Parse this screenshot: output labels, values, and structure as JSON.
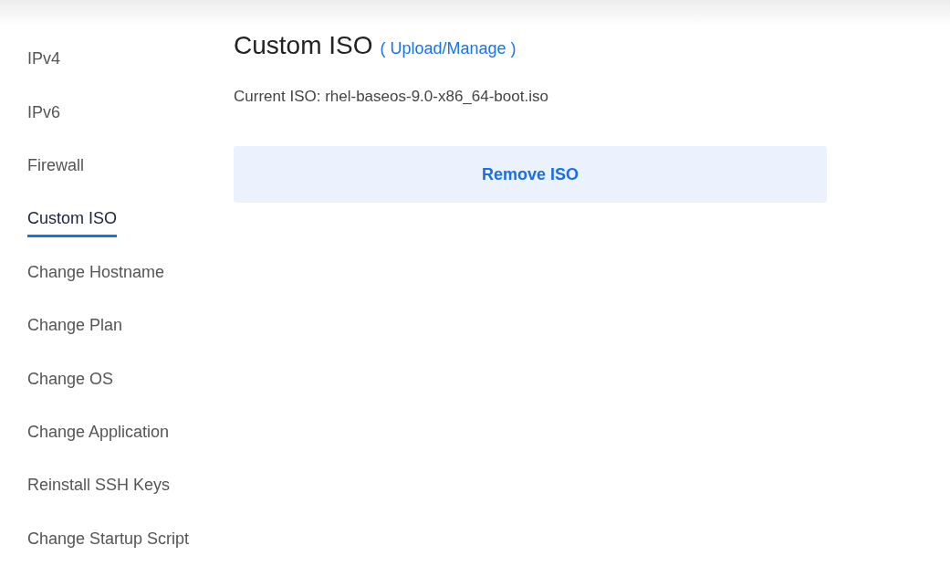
{
  "sidebar": {
    "items": [
      {
        "label": "IPv4",
        "selected": false
      },
      {
        "label": "IPv6",
        "selected": false
      },
      {
        "label": "Firewall",
        "selected": false
      },
      {
        "label": "Custom ISO",
        "selected": true
      },
      {
        "label": "Change Hostname",
        "selected": false
      },
      {
        "label": "Change Plan",
        "selected": false
      },
      {
        "label": "Change OS",
        "selected": false
      },
      {
        "label": "Change Application",
        "selected": false
      },
      {
        "label": "Reinstall SSH Keys",
        "selected": false
      },
      {
        "label": "Change Startup Script",
        "selected": false
      }
    ]
  },
  "main": {
    "title": "Custom ISO",
    "title_link": "( Upload/Manage )",
    "current_iso": "Current ISO: rhel-baseos-9.0-x86_64-boot.iso",
    "button": "Remove ISO"
  }
}
